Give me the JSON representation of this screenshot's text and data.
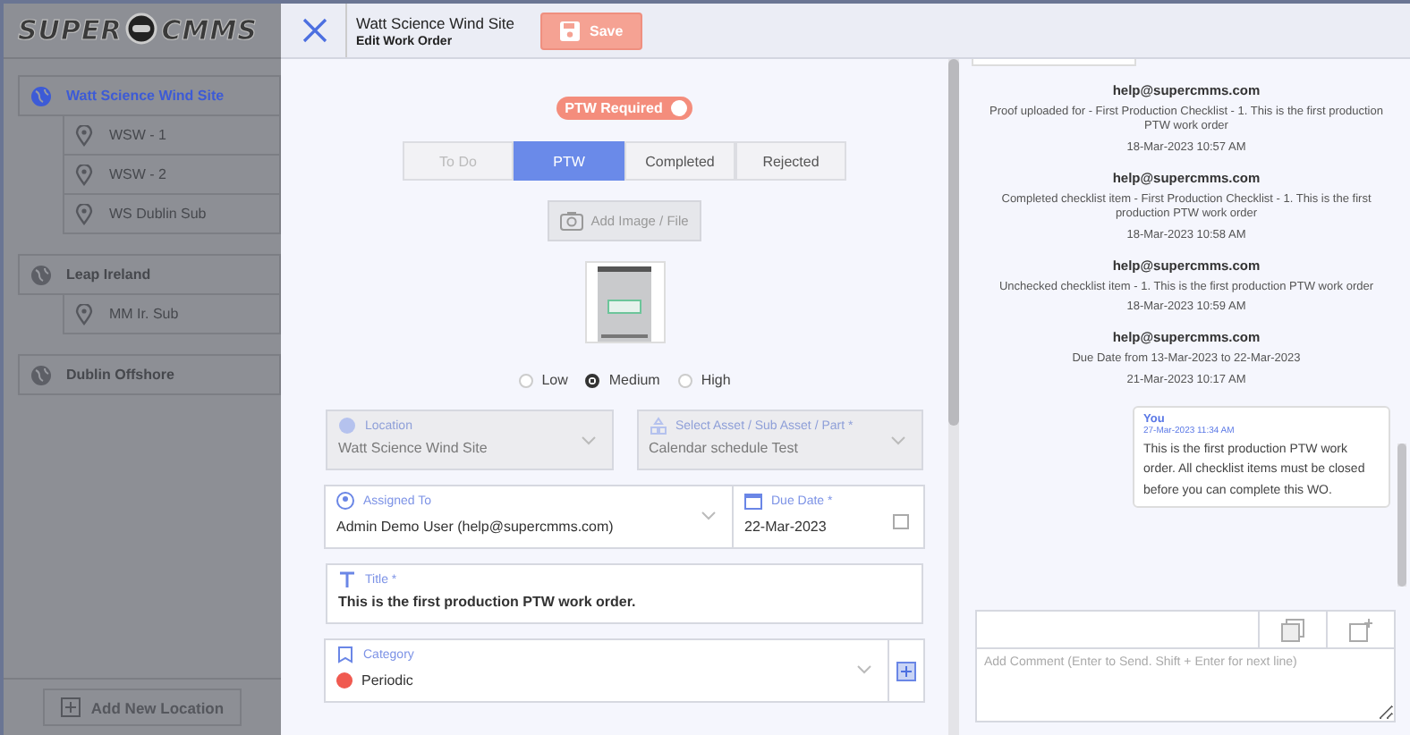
{
  "sidebar": {
    "logo_left": "SUPER",
    "logo_right": "CMMS",
    "locations": [
      {
        "name": "Watt Science Wind Site",
        "selected": true,
        "children": [
          {
            "name": "WSW - 1"
          },
          {
            "name": "WSW - 2"
          },
          {
            "name": "WS Dublin Sub"
          }
        ]
      },
      {
        "name": "Leap Ireland",
        "selected": false,
        "children": [
          {
            "name": "MM Ir. Sub"
          }
        ]
      },
      {
        "name": "Dublin Offshore",
        "selected": false
      }
    ],
    "add_button": "Add New Location"
  },
  "header": {
    "title": "Watt Science Wind Site",
    "subtitle": "Edit Work Order",
    "save_button": "Save"
  },
  "form": {
    "ptw_toggle": {
      "label": "PTW Required",
      "on": true
    },
    "tabs": [
      {
        "label": "To Do",
        "selected": false,
        "disabled": true
      },
      {
        "label": "PTW",
        "selected": true,
        "disabled": false
      },
      {
        "label": "Completed",
        "selected": false,
        "disabled": false
      },
      {
        "label": "Rejected",
        "selected": false,
        "disabled": false
      }
    ],
    "add_image_button": "Add Image / File",
    "priorities": [
      {
        "label": "Low",
        "selected": false
      },
      {
        "label": "Medium",
        "selected": true
      },
      {
        "label": "High",
        "selected": false
      }
    ],
    "location": {
      "label": "Location",
      "value": "Watt Science Wind Site",
      "disabled": true
    },
    "asset": {
      "label": "Select Asset / Sub Asset / Part *",
      "value": "Calendar schedule Test",
      "disabled": true
    },
    "assigned_to": {
      "label": "Assigned To",
      "value": "Admin Demo User (help@supercmms.com)"
    },
    "due_date": {
      "label": "Due Date *",
      "value": "22-Mar-2023"
    },
    "title": {
      "label": "Title *",
      "value": "This is the first production PTW work order."
    },
    "category": {
      "label": "Category",
      "value": "Periodic",
      "color": "#f05a50"
    }
  },
  "activity": [
    {
      "author": "help@supercmms.com",
      "text": "Proof uploaded for - First Production Checklist - 1. This is the first production PTW work order",
      "time": "18-Mar-2023 10:57 AM"
    },
    {
      "author": "help@supercmms.com",
      "text": "Completed checklist item - First Production Checklist - 1. This is the first production PTW work order",
      "time": "18-Mar-2023 10:58 AM"
    },
    {
      "author": "help@supercmms.com",
      "text": "Unchecked checklist item - 1. This is the first production PTW work order",
      "time": "18-Mar-2023 10:59 AM"
    },
    {
      "author": "help@supercmms.com",
      "text": "Due Date from 13-Mar-2023 to 22-Mar-2023",
      "time": "21-Mar-2023 10:17 AM"
    }
  ],
  "own_comment": {
    "author": "You",
    "time": "27-Mar-2023 11:34 AM",
    "text": "This is the first production PTW work order. All checklist items must be closed before you can complete this WO."
  },
  "comment_box": {
    "placeholder": "Add Comment (Enter to Send. Shift + Enter for next line)"
  }
}
